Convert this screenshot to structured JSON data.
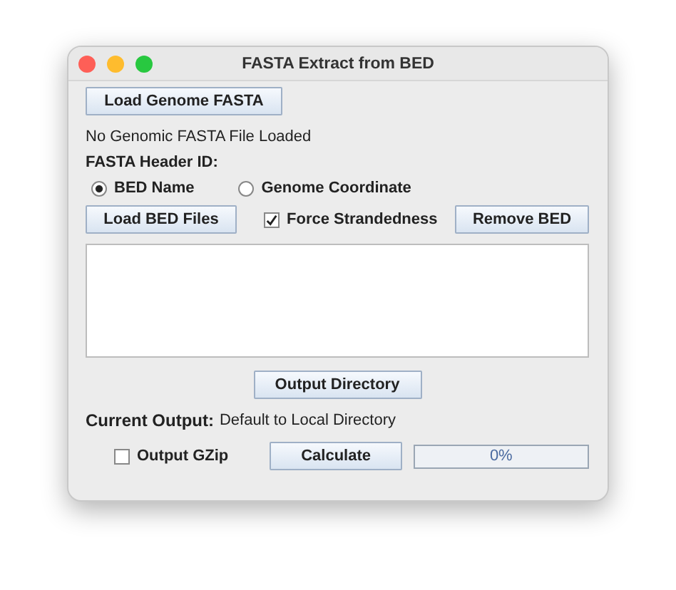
{
  "window": {
    "title": "FASTA Extract from BED"
  },
  "load_genome_button": "Load Genome FASTA",
  "genome_status": "No Genomic FASTA File Loaded",
  "header_id_label": "FASTA Header ID:",
  "header_id_options": [
    {
      "label": "BED Name",
      "selected": true
    },
    {
      "label": "Genome Coordinate",
      "selected": false
    }
  ],
  "load_bed_button": "Load BED Files",
  "force_strandedness": {
    "label": "Force Strandedness",
    "checked": true
  },
  "remove_bed_button": "Remove BED",
  "output_directory_button": "Output Directory",
  "current_output": {
    "label": "Current Output:",
    "value": "Default to Local Directory"
  },
  "output_gzip": {
    "label": "Output GZip",
    "checked": false
  },
  "calculate_button": "Calculate",
  "progress": {
    "level": 0,
    "reading": "0%"
  }
}
